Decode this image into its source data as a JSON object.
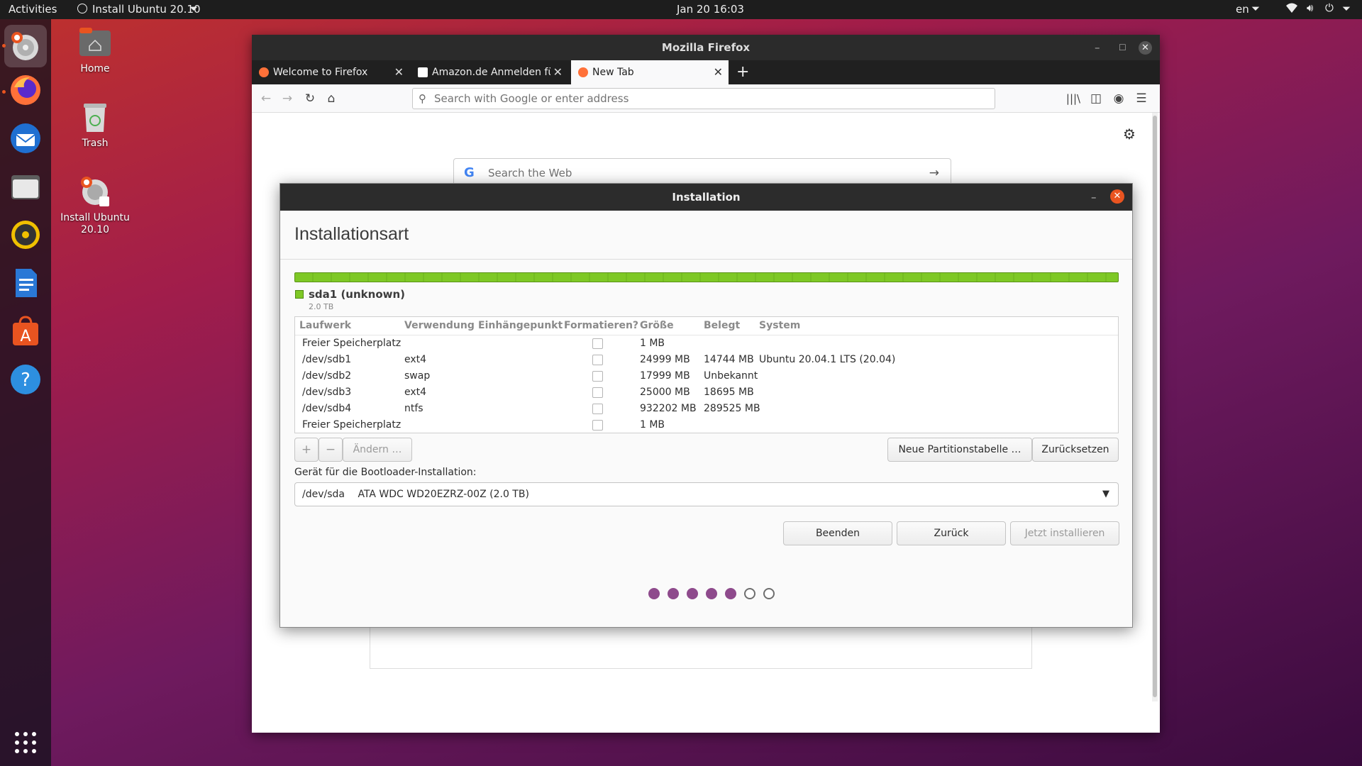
{
  "topbar": {
    "activities": "Activities",
    "app_menu": "Install Ubuntu 20.10",
    "clock": "Jan 20  16:03",
    "lang": "en"
  },
  "dock": {
    "items": [
      "ubuntu-installer-icon",
      "firefox-icon",
      "thunderbird-icon",
      "files-icon",
      "rhythmbox-icon",
      "libreoffice-writer-icon",
      "software-center-icon",
      "help-icon",
      "show-apps-icon"
    ]
  },
  "desktop": {
    "home_label": "Home",
    "trash_label": "Trash",
    "install_label": "Install Ubuntu 20.10"
  },
  "firefox": {
    "window_title": "Mozilla Firefox",
    "tabs": [
      {
        "label": "Welcome to Firefox",
        "active": false
      },
      {
        "label": "Amazon.de Anmelden für",
        "active": false
      },
      {
        "label": "New Tab",
        "active": true
      }
    ],
    "url_placeholder": "Search with Google or enter address",
    "search_placeholder": "Search the Web"
  },
  "installer": {
    "window_title": "Installation",
    "heading": "Installationsart",
    "disk_label": "sda1 (unknown)",
    "disk_size": "2.0 TB",
    "columns": [
      "Laufwerk",
      "Verwendung",
      "Einhängepunkt",
      "Formatieren?",
      "Größe",
      "Belegt",
      "System"
    ],
    "rows": [
      {
        "drive": "Freier Speicherplatz",
        "use": "",
        "mount": "",
        "size": "1 MB",
        "used": "",
        "system": ""
      },
      {
        "drive": "/dev/sdb1",
        "use": "ext4",
        "mount": "",
        "size": "24999 MB",
        "used": "14744 MB",
        "system": "Ubuntu 20.04.1 LTS (20.04)"
      },
      {
        "drive": "/dev/sdb2",
        "use": "swap",
        "mount": "",
        "size": "17999 MB",
        "used": "Unbekannt",
        "system": ""
      },
      {
        "drive": "/dev/sdb3",
        "use": "ext4",
        "mount": "",
        "size": "25000 MB",
        "used": "18695 MB",
        "system": ""
      },
      {
        "drive": "/dev/sdb4",
        "use": "ntfs",
        "mount": "",
        "size": "932202 MB",
        "used": "289525 MB",
        "system": ""
      },
      {
        "drive": "Freier Speicherplatz",
        "use": "",
        "mount": "",
        "size": "1 MB",
        "used": "",
        "system": ""
      }
    ],
    "add_label": "+",
    "remove_label": "−",
    "change_label": "Ändern …",
    "new_table_label": "Neue Partitionstabelle …",
    "reset_label": "Zurücksetzen",
    "bootloader_label": "Gerät für die Bootloader-Installation:",
    "bootloader_device": "/dev/sda",
    "bootloader_desc": "ATA WDC WD20EZRZ-00Z (2.0 TB)",
    "quit_label": "Beenden",
    "back_label": "Zurück",
    "install_label": "Jetzt installieren",
    "progress_steps_total": 7,
    "progress_steps_done": 5,
    "accent": "#8e4a8c"
  }
}
